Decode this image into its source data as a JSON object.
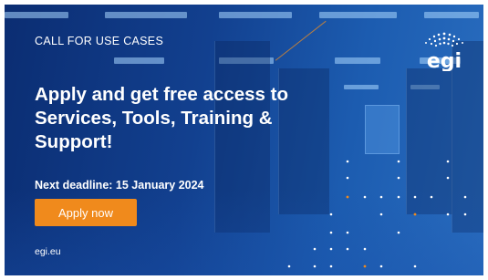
{
  "banner": {
    "eyebrow": "CALL FOR USE CASES",
    "headline": "Apply and get free access to Services, Tools, Training & Support!",
    "deadline": "Next deadline: 15 January 2024",
    "apply_button_label": "Apply now",
    "website": "egi.eu",
    "logo_text": "egi"
  },
  "colors": {
    "background_dark": "#0b2d72",
    "background_light": "#2a6ec0",
    "accent": "#f08a1c",
    "text": "#ffffff"
  },
  "icons": {
    "logo": "egi-logo-icon"
  }
}
